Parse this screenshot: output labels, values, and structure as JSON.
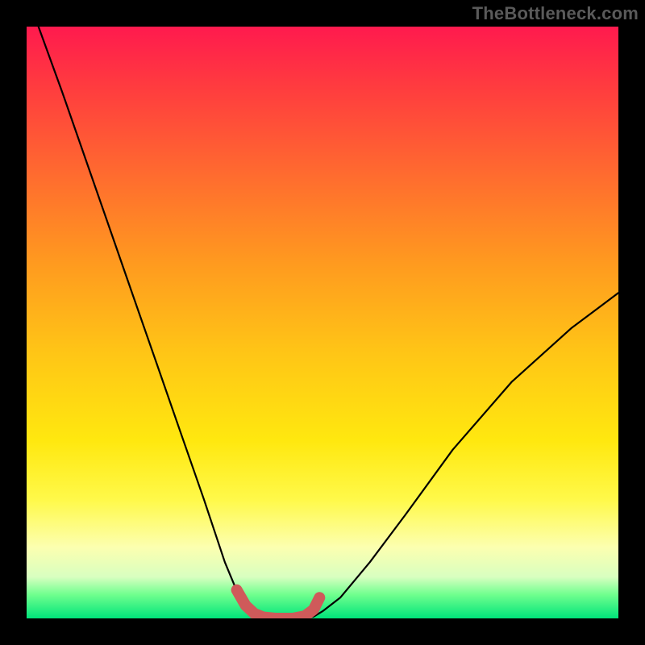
{
  "watermark": "TheBottleneck.com",
  "chart_data": {
    "type": "line",
    "title": "",
    "xlabel": "",
    "ylabel": "",
    "xlim": [
      0,
      1
    ],
    "ylim": [
      0,
      1
    ],
    "series": [
      {
        "name": "bottleneck-curve",
        "x": [
          0.02,
          0.06,
          0.1,
          0.14,
          0.18,
          0.22,
          0.26,
          0.3,
          0.335,
          0.36,
          0.38,
          0.395,
          0.41,
          0.44,
          0.47,
          0.485,
          0.5,
          0.53,
          0.58,
          0.64,
          0.72,
          0.82,
          0.92,
          1.0
        ],
        "y": [
          1.0,
          0.89,
          0.775,
          0.66,
          0.545,
          0.43,
          0.315,
          0.2,
          0.095,
          0.035,
          0.012,
          0.003,
          0.0,
          0.0,
          0.0,
          0.003,
          0.012,
          0.035,
          0.095,
          0.175,
          0.285,
          0.4,
          0.49,
          0.55
        ]
      },
      {
        "name": "flat-bottom-highlight",
        "x": [
          0.355,
          0.37,
          0.385,
          0.4,
          0.42,
          0.45,
          0.47,
          0.485,
          0.495
        ],
        "y": [
          0.048,
          0.022,
          0.008,
          0.002,
          0.0,
          0.0,
          0.004,
          0.015,
          0.035
        ]
      }
    ],
    "gradient_colors": {
      "top": "#ff1a4e",
      "mid": "#ffe80f",
      "bottom": "#00e37a"
    },
    "highlight_color": "#cf5a5a"
  }
}
